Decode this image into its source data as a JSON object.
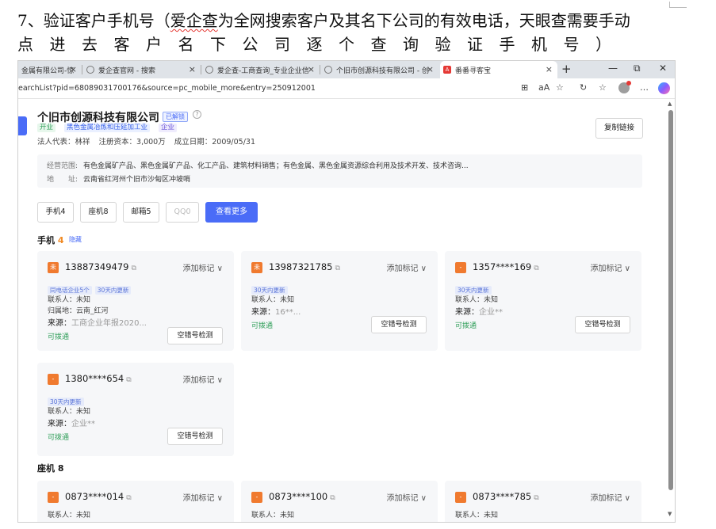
{
  "doc": {
    "line1_prefix": "7、验证客户手机号（",
    "line1_squiggle": "爱企查",
    "line1_suffix": "为全网搜索客户及其名下公司的有效电话，天眼查需要手动",
    "line2": "点进去客户名下公司逐个查询验证手机号）"
  },
  "browser": {
    "tabs": [
      {
        "label": "金属有限公司-惊",
        "close": "×"
      },
      {
        "label": "爱企查官网 - 搜索",
        "close": "×"
      },
      {
        "label": "爱企查-工商查询_专业企业信",
        "close": "×"
      },
      {
        "label": "个旧市创源科技有限公司 - 创",
        "close": "×"
      },
      {
        "label": "番番寻客宝",
        "close": "×",
        "icon_text": "A"
      }
    ],
    "new_tab": "+",
    "window_controls": {
      "minimize": "—",
      "restore": "⧉",
      "close": "✕"
    },
    "url": "earchList?pid=68089031700176&source=pc_mobile_more&entry=250912001",
    "address_icons": {
      "split": "⊞",
      "read": "aA",
      "favorite": "☆",
      "refresh": "↻",
      "collections": "☆",
      "more": "…"
    }
  },
  "company": {
    "name": "个旧市创源科技有限公司",
    "claimed_badge": "已解锁",
    "help": "?",
    "tags": [
      "开业",
      "黑色金属冶炼和压延加工业",
      "企业"
    ],
    "legal_line": "法人代表：林祥 注册资本：3,000万 成立日期：2009/05/31",
    "copy_link": "复制链接",
    "scope_label": "经营范围:",
    "scope_value": "有色金属矿产品、黑色金属矿产品、化工产品、建筑材料销售；有色金属、黑色金属资源综合利用及技术开发、技术咨询...",
    "address_label": "地　　址:",
    "address_value": "云南省红河州个旧市沙甸区冲坡哨"
  },
  "filters": {
    "mobile": "手机4",
    "landline": "座机8",
    "email": "邮箱5",
    "qq": "QQ0",
    "more": "查看更多"
  },
  "mobile_section": {
    "title": "手机",
    "count": "4",
    "hide": "隐藏"
  },
  "landline_section": {
    "title": "座机",
    "count": "8"
  },
  "mobile_cards": [
    {
      "icon": "未",
      "phone": "13887349479",
      "copy": "⧉",
      "mark": "添加标记 ∨",
      "chips": [
        "同电话企业5个",
        "30天内更新"
      ],
      "contact": "联系人：未知",
      "region": "归属地：云南_红河",
      "source_label": "来源：",
      "source_value": "工商企业年报2020...",
      "status": "可拨通",
      "check": "空错号检测"
    },
    {
      "icon": "未",
      "phone": "13987321785",
      "copy": "⧉",
      "mark": "添加标记 ∨",
      "chips": [
        "30天内更新"
      ],
      "contact": "联系人：未知",
      "source_label": "来源：",
      "source_value": "16**...",
      "status": "可拨通",
      "check": "空错号检测"
    },
    {
      "icon": "-",
      "phone": "1357****169",
      "copy": "⧉",
      "mark": "添加标记 ∨",
      "chips": [
        "30天内更新"
      ],
      "contact": "联系人：未知",
      "source_label": "来源：",
      "source_value": "企业**",
      "status": "可拨通",
      "check": "空错号检测"
    },
    {
      "icon": "-",
      "phone": "1380****654",
      "copy": "⧉",
      "mark": "添加标记 ∨",
      "chips": [
        "30天内更新"
      ],
      "contact": "联系人：未知",
      "source_label": "来源：",
      "source_value": "企业**",
      "status": "可拨通",
      "check": "空错号检测"
    }
  ],
  "landline_cards": [
    {
      "icon": "-",
      "phone": "0873****014",
      "copy": "⧉",
      "mark": "添加标记 ∨",
      "contact": "联系人：未知"
    },
    {
      "icon": "-",
      "phone": "0873****100",
      "copy": "⧉",
      "mark": "添加标记 ∨",
      "contact": "联系人：未知"
    },
    {
      "icon": "-",
      "phone": "0873****785",
      "copy": "⧉",
      "mark": "添加标记 ∨",
      "contact": "联系人：未知"
    }
  ],
  "scroll": {
    "up": "▲",
    "down": "▼"
  },
  "colors": {
    "accent": "#4a6cf7",
    "orange": "#f07a2f",
    "green": "#2e9e58"
  }
}
